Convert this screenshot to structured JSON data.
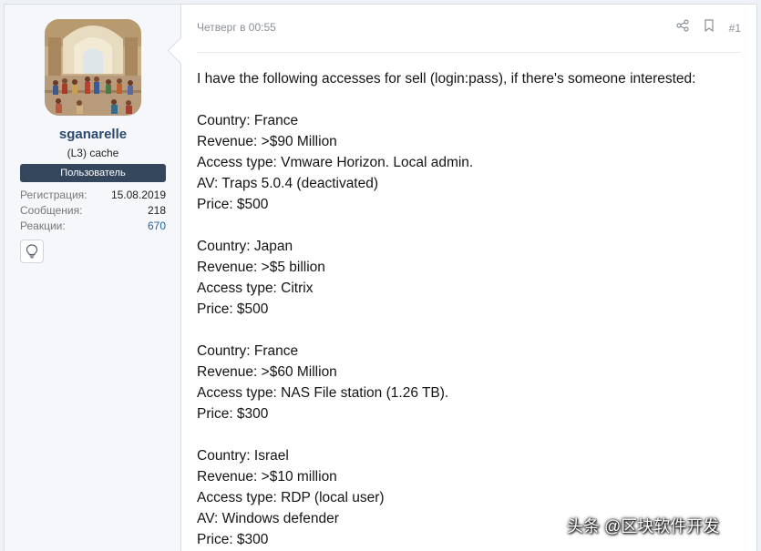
{
  "post": {
    "date": "Четверг в 00:55",
    "number": "#1",
    "lines": [
      "I have the following accesses for sell (login:pass), if there's someone interested:",
      "",
      "Country: France",
      "Revenue: >$90 Million",
      "Access type: Vmware Horizon. Local admin.",
      "AV: Traps 5.0.4 (deactivated)",
      "Price: $500",
      "",
      "Country: Japan",
      "Revenue: >$5 billion",
      "Access type: Citrix",
      "Price: $500",
      "",
      "Country: France",
      "Revenue: >$60 Million",
      "Access type: NAS File station (1.26 TB).",
      "Price: $300",
      "",
      "Country: Israel",
      "Revenue: >$10 million",
      "Access type: RDP (local user)",
      "AV: Windows defender",
      "Price: $300"
    ]
  },
  "user": {
    "name": "sganarelle",
    "title": "(L3) cache",
    "banner": "Пользователь",
    "stats": [
      {
        "label": "Регистрация:",
        "value": "15.08.2019"
      },
      {
        "label": "Сообщения:",
        "value": "218"
      },
      {
        "label": "Реакции:",
        "value": "670"
      }
    ]
  },
  "icons": {
    "share": "share-icon",
    "bookmark": "bookmark-icon",
    "trophy": "lightbulb-icon"
  },
  "watermark": "头条 @区块软件开发",
  "colors": {
    "username": "#2c4a6e",
    "banner": "#35475c",
    "link": "#2563a0"
  }
}
